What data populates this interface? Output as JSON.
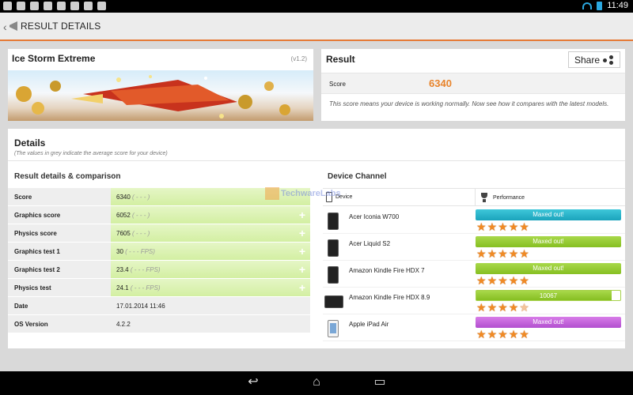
{
  "statusbar": {
    "time": "11:49"
  },
  "header": {
    "title": "RESULT DETAILS"
  },
  "test": {
    "name": "Ice Storm Extreme",
    "version": "(v1.2)"
  },
  "result": {
    "title": "Result",
    "share_label": "Share",
    "score_label": "Score",
    "score_value": "6340",
    "description": "This score means your device is working normally. Now see how it compares with the latest models."
  },
  "details": {
    "title": "Details",
    "note": "(The values in grey indicate the average score for your device)",
    "left_section": "Result details & comparison",
    "right_section": "Device Channel",
    "rows": [
      {
        "label": "Score",
        "value": "6340",
        "avg": "( - - - )"
      },
      {
        "label": "Graphics score",
        "value": "6052",
        "avg": "( - - - )"
      },
      {
        "label": "Physics score",
        "value": "7605",
        "avg": "( - - - )"
      },
      {
        "label": "Graphics test 1",
        "value": "30",
        "avg": "( - - - FPS)"
      },
      {
        "label": "Graphics test 2",
        "value": "23.4",
        "avg": "( - - - FPS)"
      },
      {
        "label": "Physics test",
        "value": "24.1",
        "avg": "( - - - FPS)"
      },
      {
        "label": "Date",
        "value": "17.01.2014 11:46",
        "avg": ""
      },
      {
        "label": "OS Version",
        "value": "4.2.2",
        "avg": ""
      }
    ],
    "device_header": {
      "device": "Device",
      "performance": "Performance"
    },
    "devices": [
      {
        "name": "Acer Iconia W700",
        "bar_label": "Maxed out!",
        "bar_color": "#1aa3bc",
        "stars": 5
      },
      {
        "name": "Acer Liquid S2",
        "bar_label": "Maxed out!",
        "bar_color": "#86bf22",
        "stars": 5
      },
      {
        "name": "Amazon Kindle Fire HDX 7",
        "bar_label": "Maxed out!",
        "bar_color": "#86bf22",
        "stars": 5
      },
      {
        "name": "Amazon Kindle Fire HDX 8.9",
        "bar_label": "10067",
        "bar_color": "#86bf22",
        "stars": 4.5,
        "fill_fraction": 0.94
      },
      {
        "name": "Apple iPad Air",
        "bar_label": "Maxed out!",
        "bar_color": "#b24fcf",
        "stars": 5
      }
    ]
  },
  "watermark": {
    "text": "TechwareLabs"
  },
  "colors": {
    "accent": "#e57a36",
    "score": "#e8842c",
    "star": "#f08a24"
  },
  "nav": {
    "back_icon": "back-icon",
    "home_icon": "home-icon",
    "recents_icon": "recents-icon"
  }
}
